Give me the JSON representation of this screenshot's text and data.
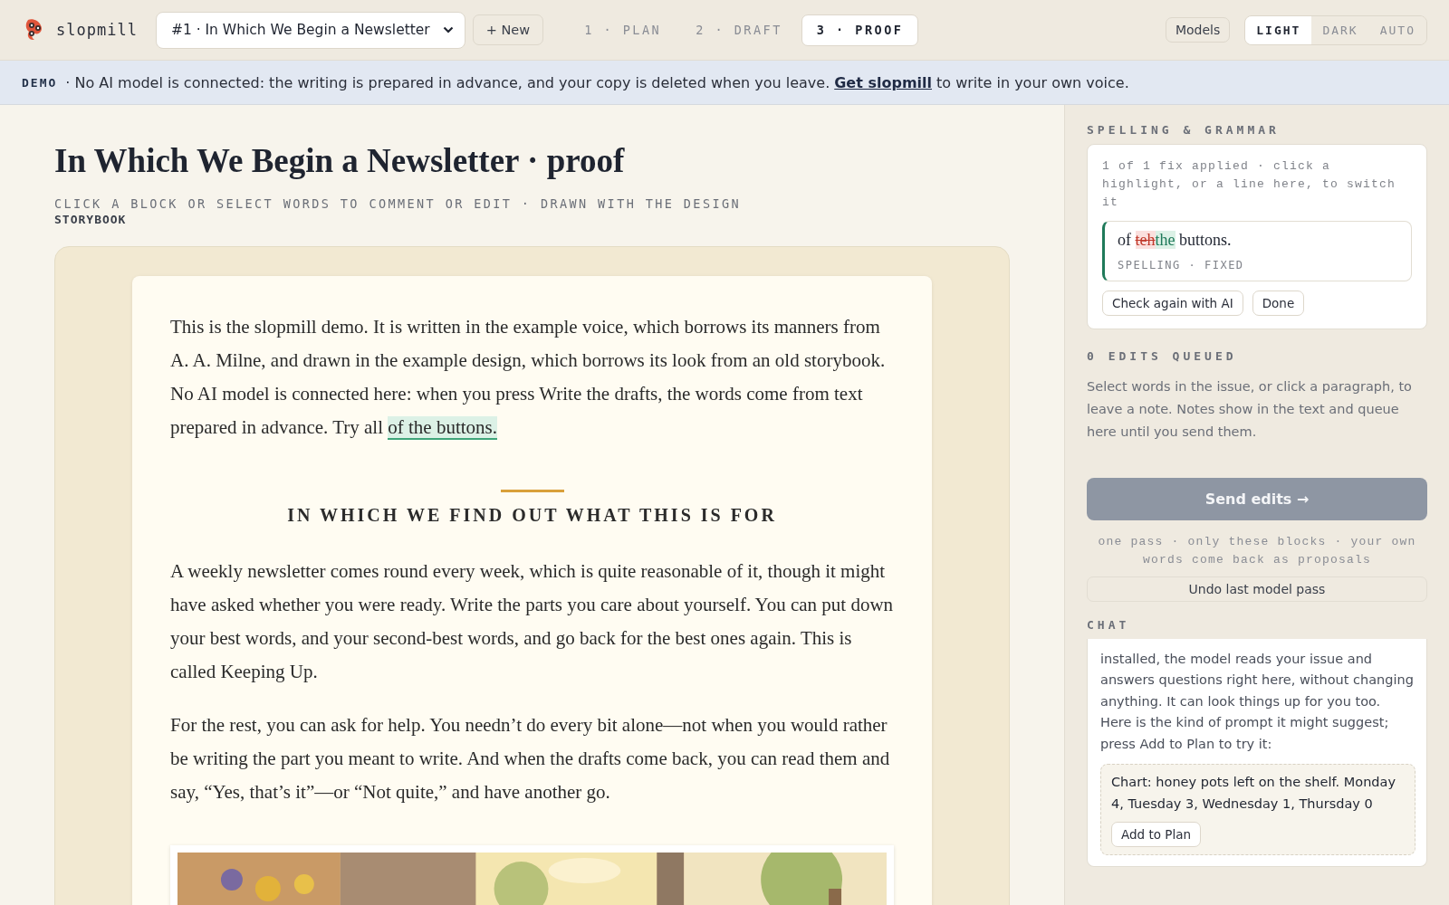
{
  "header": {
    "brand": "slopmill",
    "issue_select": "#1 · In Which We Begin a Newsletter",
    "new_button": "+ New",
    "steps": [
      {
        "label": "1 · PLAN",
        "selected": false
      },
      {
        "label": "2 · DRAFT",
        "selected": false
      },
      {
        "label": "3 · PROOF",
        "selected": true
      }
    ],
    "models_button": "Models",
    "themes": [
      {
        "label": "LIGHT",
        "selected": true
      },
      {
        "label": "DARK",
        "selected": false
      },
      {
        "label": "AUTO",
        "selected": false
      }
    ]
  },
  "banner": {
    "tag": "DEMO",
    "text": "· No AI model is connected: the writing is prepared in advance, and your copy is deleted when you leave.",
    "link": "Get slopmill",
    "after": "to write in your own voice."
  },
  "document": {
    "title": "In Which We Begin a Newsletter · proof",
    "subtitle": "CLICK A BLOCK OR SELECT WORDS TO COMMENT OR EDIT · DRAWN WITH THE DESIGN",
    "design_name": "STORYBOOK",
    "blocks": [
      {
        "kind": "paragraph",
        "text": "This is the slopmill demo. It is written in the example voice, which borrows its manners from A. A. Milne, and drawn in the example design, which borrows its look from an old storybook. No AI model is connected here: when you press Write the drafts, the words come from text prepared in advance. Try all ",
        "highlight": "of the buttons."
      },
      {
        "kind": "heading",
        "text": "IN WHICH WE FIND OUT WHAT THIS IS FOR"
      },
      {
        "kind": "paragraph",
        "text": "A weekly newsletter comes round every week, which is quite reasonable of it, though it might have asked whether you were ready. Write the parts you care about yourself. You can put down your best words, and your second-best words, and go back for the best ones again. This is called Keeping Up."
      },
      {
        "kind": "paragraph",
        "text": "For the rest, you can ask for help. You needn’t do every bit alone—not when you would rather be writing the part you meant to write. And when the drafts come back, you can read them and say, “Yes, that’s it”—or “Not quite,” and have another go."
      },
      {
        "kind": "picture"
      }
    ]
  },
  "sidebar": {
    "spelling": {
      "heading": "SPELLING & GRAMMAR",
      "summary": "1 of 1 fix applied · click a highlight, or a line here, to switch it",
      "fix": {
        "before": "of",
        "removed": "teh",
        "inserted": "the",
        "after": "buttons.",
        "meta": "SPELLING · FIXED"
      },
      "buttons": [
        "Check again with AI",
        "Done"
      ]
    },
    "edits": {
      "heading": "0 EDITS QUEUED",
      "hint": "Select words in the issue, or click a paragraph, to leave a note. Notes show in the text and queue here until you send them.",
      "send_button": {
        "label": "Send edits →",
        "disabled": true
      },
      "note": "one pass · only these blocks · your own words come back as proposals",
      "undo_button": "Undo last model pass"
    },
    "chat": {
      "heading": "CHAT",
      "message": "installed, the model reads your issue and answers questions right here, without changing anything. It can look things up for you too. Here is the kind of prompt it might suggest; press Add to Plan to try it:",
      "suggestion": {
        "text": "Chart: honey pots left on the shelf. Monday 4, Tuesday 3, Wednesday 1, Thursday 0",
        "button": "Add to Plan"
      }
    }
  }
}
